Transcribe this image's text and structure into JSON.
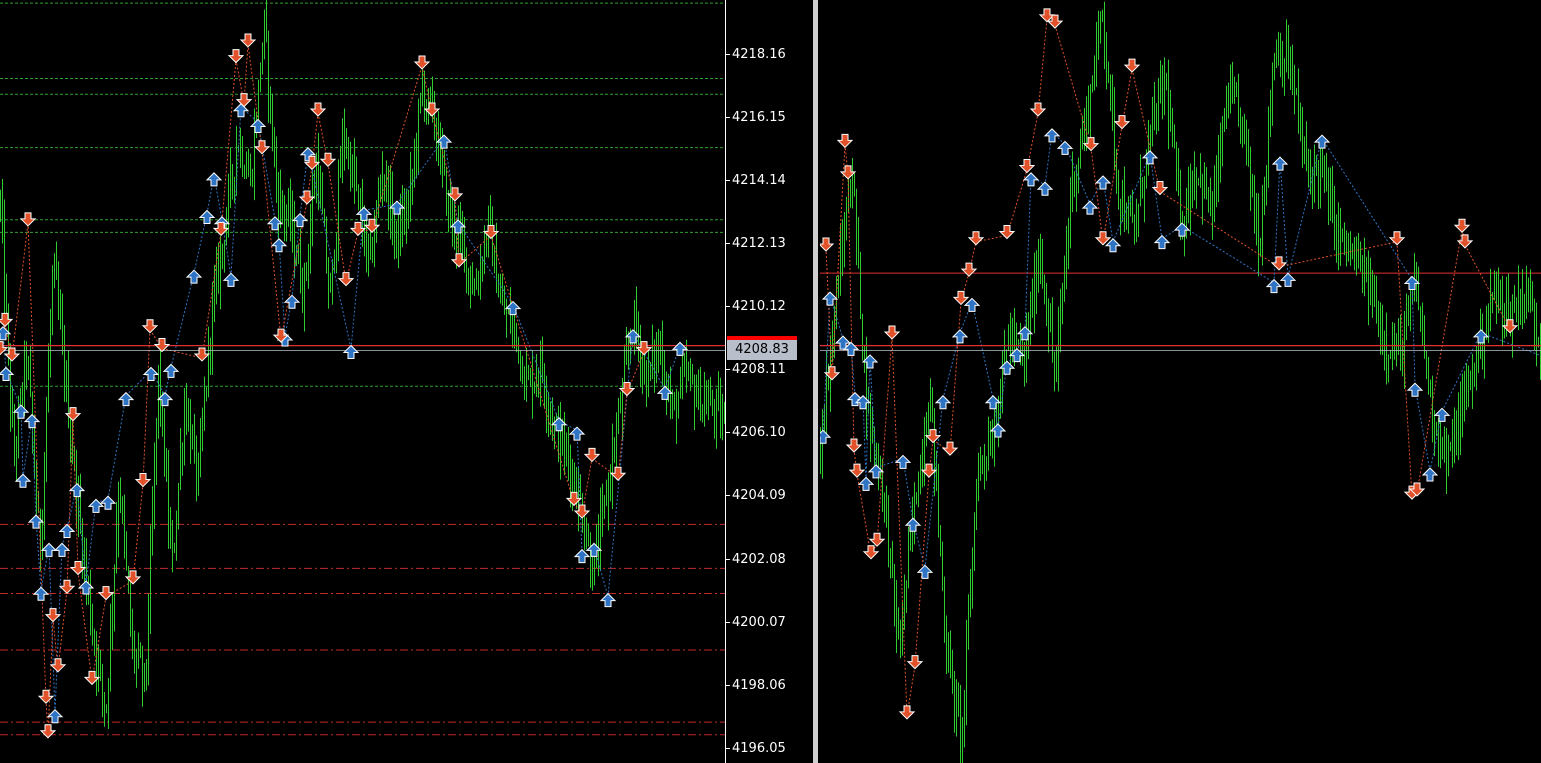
{
  "chart_data": {
    "type": "candlestick",
    "title": "",
    "xlabel": "",
    "ylabel": "",
    "ylim": [
      4195.6,
      4219.9
    ],
    "y_ticks": [
      "4218.16",
      "4216.15",
      "4214.14",
      "4212.13",
      "4210.12",
      "4208.11",
      "4206.10",
      "4204.09",
      "4202.08",
      "4200.07",
      "4198.06",
      "4196.05"
    ],
    "current_price": "4208.83",
    "current_price_line_color": "#e03030",
    "candle_color": "#2ecc2e",
    "buy_marker_color": "#2f74c4",
    "sell_marker_color": "#e2522a",
    "left_chart": {
      "close_path": [
        4213.4,
        4205.2,
        4208.7,
        4202.3,
        4211.5,
        4207.5,
        4203.3,
        4199.8,
        4197.2,
        4204.7,
        4199.2,
        4198.1,
        4208.1,
        4201.7,
        4207.2,
        4204.5,
        4209.8,
        4212.6,
        4215.5,
        4214.1,
        4219.2,
        4213.6,
        4212.8,
        4210.6,
        4214.8,
        4210.2,
        4215.7,
        4213.8,
        4211.4,
        4214.6,
        4212.3,
        4213.4,
        4217.1,
        4215.9,
        4213.2,
        4212.1,
        4210.6,
        4212.8,
        4210.1,
        4209.4,
        4207.6,
        4208.3,
        4206.3,
        4205.4,
        4203.9,
        4201.6,
        4204.2,
        4206.8,
        4209.8,
        4207.8,
        4208.9,
        4206.7,
        4207.9,
        4207.2,
        4206.9,
        4206.4
      ],
      "resistance_lines": [
        4219.8,
        4217.4,
        4216.9,
        4215.2,
        4212.9,
        4212.5,
        4207.6
      ],
      "support_lines": [
        4203.2,
        4201.8,
        4201.0,
        4199.2,
        4196.9,
        4196.5
      ],
      "buy_arrows": [
        [
          3,
          4209.4
        ],
        [
          6,
          4208.1
        ],
        [
          21,
          4206.9
        ],
        [
          23,
          4204.7
        ],
        [
          32,
          4206.6
        ],
        [
          36,
          4203.4
        ],
        [
          41,
          4201.1
        ],
        [
          49,
          4202.5
        ],
        [
          55,
          4197.2
        ],
        [
          62,
          4202.5
        ],
        [
          67,
          4203.1
        ],
        [
          77,
          4204.4
        ],
        [
          86,
          4201.3
        ],
        [
          96,
          4203.9
        ],
        [
          108,
          4204.0
        ],
        [
          126,
          4207.3
        ],
        [
          151,
          4208.1
        ],
        [
          165,
          4207.3
        ],
        [
          171,
          4208.2
        ],
        [
          194,
          4211.2
        ],
        [
          207,
          4213.1
        ],
        [
          214,
          4214.3
        ],
        [
          222,
          4212.9
        ],
        [
          231,
          4211.1
        ],
        [
          241,
          4216.5
        ],
        [
          258,
          4216.0
        ],
        [
          275,
          4212.9
        ],
        [
          279,
          4212.2
        ],
        [
          285,
          4209.2
        ],
        [
          292,
          4210.4
        ],
        [
          300,
          4213.0
        ],
        [
          308,
          4215.1
        ],
        [
          351,
          4208.8
        ],
        [
          364,
          4213.2
        ],
        [
          397,
          4213.4
        ],
        [
          444,
          4215.5
        ],
        [
          458,
          4212.8
        ],
        [
          513,
          4210.2
        ],
        [
          559,
          4206.5
        ],
        [
          577,
          4206.2
        ],
        [
          582,
          4202.3
        ],
        [
          594,
          4202.5
        ],
        [
          608,
          4200.9
        ],
        [
          633,
          4209.3
        ],
        [
          665,
          4207.5
        ],
        [
          680,
          4208.9
        ]
      ],
      "sell_arrows": [
        [
          0,
          4208.7
        ],
        [
          5,
          4209.6
        ],
        [
          12,
          4208.5
        ],
        [
          28,
          4212.8
        ],
        [
          46,
          4197.6
        ],
        [
          48,
          4196.5
        ],
        [
          53,
          4200.2
        ],
        [
          58,
          4198.6
        ],
        [
          67,
          4201.1
        ],
        [
          73,
          4206.6
        ],
        [
          78,
          4201.7
        ],
        [
          92,
          4198.2
        ],
        [
          106,
          4200.9
        ],
        [
          133,
          4201.4
        ],
        [
          143,
          4204.5
        ],
        [
          150,
          4209.4
        ],
        [
          162,
          4208.8
        ],
        [
          202,
          4208.5
        ],
        [
          221,
          4212.5
        ],
        [
          236,
          4218.0
        ],
        [
          244,
          4216.6
        ],
        [
          248,
          4218.5
        ],
        [
          262,
          4215.1
        ],
        [
          281,
          4209.1
        ],
        [
          307,
          4213.5
        ],
        [
          312,
          4214.6
        ],
        [
          318,
          4216.3
        ],
        [
          328,
          4214.7
        ],
        [
          346,
          4210.9
        ],
        [
          358,
          4212.5
        ],
        [
          372,
          4212.6
        ],
        [
          422,
          4217.8
        ],
        [
          432,
          4216.3
        ],
        [
          455,
          4213.6
        ],
        [
          459,
          4211.5
        ],
        [
          491,
          4212.4
        ],
        [
          574,
          4203.9
        ],
        [
          582,
          4203.5
        ],
        [
          592,
          4205.3
        ],
        [
          618,
          4204.7
        ],
        [
          627,
          4207.4
        ],
        [
          644,
          4208.7
        ]
      ]
    },
    "right_chart": {
      "close_path": [
        4205.9,
        4210.3,
        4214.6,
        4206.8,
        4204.4,
        4199.2,
        4203.8,
        4207.5,
        4199.5,
        4196.2,
        4204.9,
        4206.1,
        4209.2,
        4208.4,
        4212.0,
        4207.8,
        4213.9,
        4216.2,
        4219.6,
        4213.9,
        4212.4,
        4215.5,
        4217.4,
        4212.8,
        4214.6,
        4213.1,
        4216.9,
        4215.8,
        4212.1,
        4218.5,
        4217.7,
        4214.5,
        4214.4,
        4212.4,
        4211.7,
        4210.8,
        4209.1,
        4208.6,
        4210.9,
        4206.9,
        4205.1,
        4207.0,
        4208.8,
        4210.6,
        4209.9,
        4210.7,
        4208.9
      ],
      "resistance_line": 4211.2,
      "buy_arrows": [
        [
          3,
          4206.1
        ],
        [
          10,
          4210.5
        ],
        [
          23,
          4209.1
        ],
        [
          31,
          4208.9
        ],
        [
          35,
          4207.3
        ],
        [
          43,
          4207.2
        ],
        [
          46,
          4204.6
        ],
        [
          50,
          4208.5
        ],
        [
          56,
          4205.0
        ],
        [
          83,
          4205.3
        ],
        [
          93,
          4203.3
        ],
        [
          105,
          4201.8
        ],
        [
          123,
          4207.2
        ],
        [
          140,
          4209.3
        ],
        [
          152,
          4210.3
        ],
        [
          173,
          4207.2
        ],
        [
          178,
          4206.3
        ],
        [
          187,
          4208.3
        ],
        [
          197,
          4208.7
        ],
        [
          205,
          4209.4
        ],
        [
          211,
          4214.3
        ],
        [
          225,
          4214.0
        ],
        [
          232,
          4215.7
        ],
        [
          245,
          4215.3
        ],
        [
          270,
          4213.4
        ],
        [
          283,
          4214.2
        ],
        [
          293,
          4212.2
        ],
        [
          330,
          4215.0
        ],
        [
          342,
          4212.3
        ],
        [
          362,
          4212.7
        ],
        [
          454,
          4210.9
        ],
        [
          460,
          4214.8
        ],
        [
          468,
          4211.1
        ],
        [
          502,
          4215.5
        ],
        [
          592,
          4211.0
        ],
        [
          595,
          4207.6
        ],
        [
          610,
          4204.9
        ],
        [
          622,
          4206.8
        ],
        [
          661,
          4209.3
        ],
        [
          735,
          4208.4
        ]
      ],
      "sell_arrows": [
        [
          6,
          4212.0
        ],
        [
          12,
          4207.9
        ],
        [
          25,
          4215.3
        ],
        [
          28,
          4214.3
        ],
        [
          34,
          4205.6
        ],
        [
          37,
          4204.8
        ],
        [
          51,
          4202.2
        ],
        [
          57,
          4202.6
        ],
        [
          72,
          4209.2
        ],
        [
          87,
          4197.1
        ],
        [
          95,
          4198.7
        ],
        [
          109,
          4204.8
        ],
        [
          113,
          4205.9
        ],
        [
          130,
          4205.5
        ],
        [
          141,
          4210.3
        ],
        [
          149,
          4211.2
        ],
        [
          156,
          4212.2
        ],
        [
          187,
          4212.4
        ],
        [
          207,
          4214.5
        ],
        [
          218,
          4216.3
        ],
        [
          227,
          4219.3
        ],
        [
          235,
          4219.1
        ],
        [
          271,
          4215.2
        ],
        [
          283,
          4212.2
        ],
        [
          302,
          4215.9
        ],
        [
          312,
          4217.7
        ],
        [
          340,
          4213.8
        ],
        [
          459,
          4211.4
        ],
        [
          577,
          4212.2
        ],
        [
          592,
          4204.1
        ],
        [
          597,
          4204.2
        ],
        [
          642,
          4212.6
        ],
        [
          645,
          4212.1
        ],
        [
          690,
          4209.4
        ]
      ]
    }
  }
}
